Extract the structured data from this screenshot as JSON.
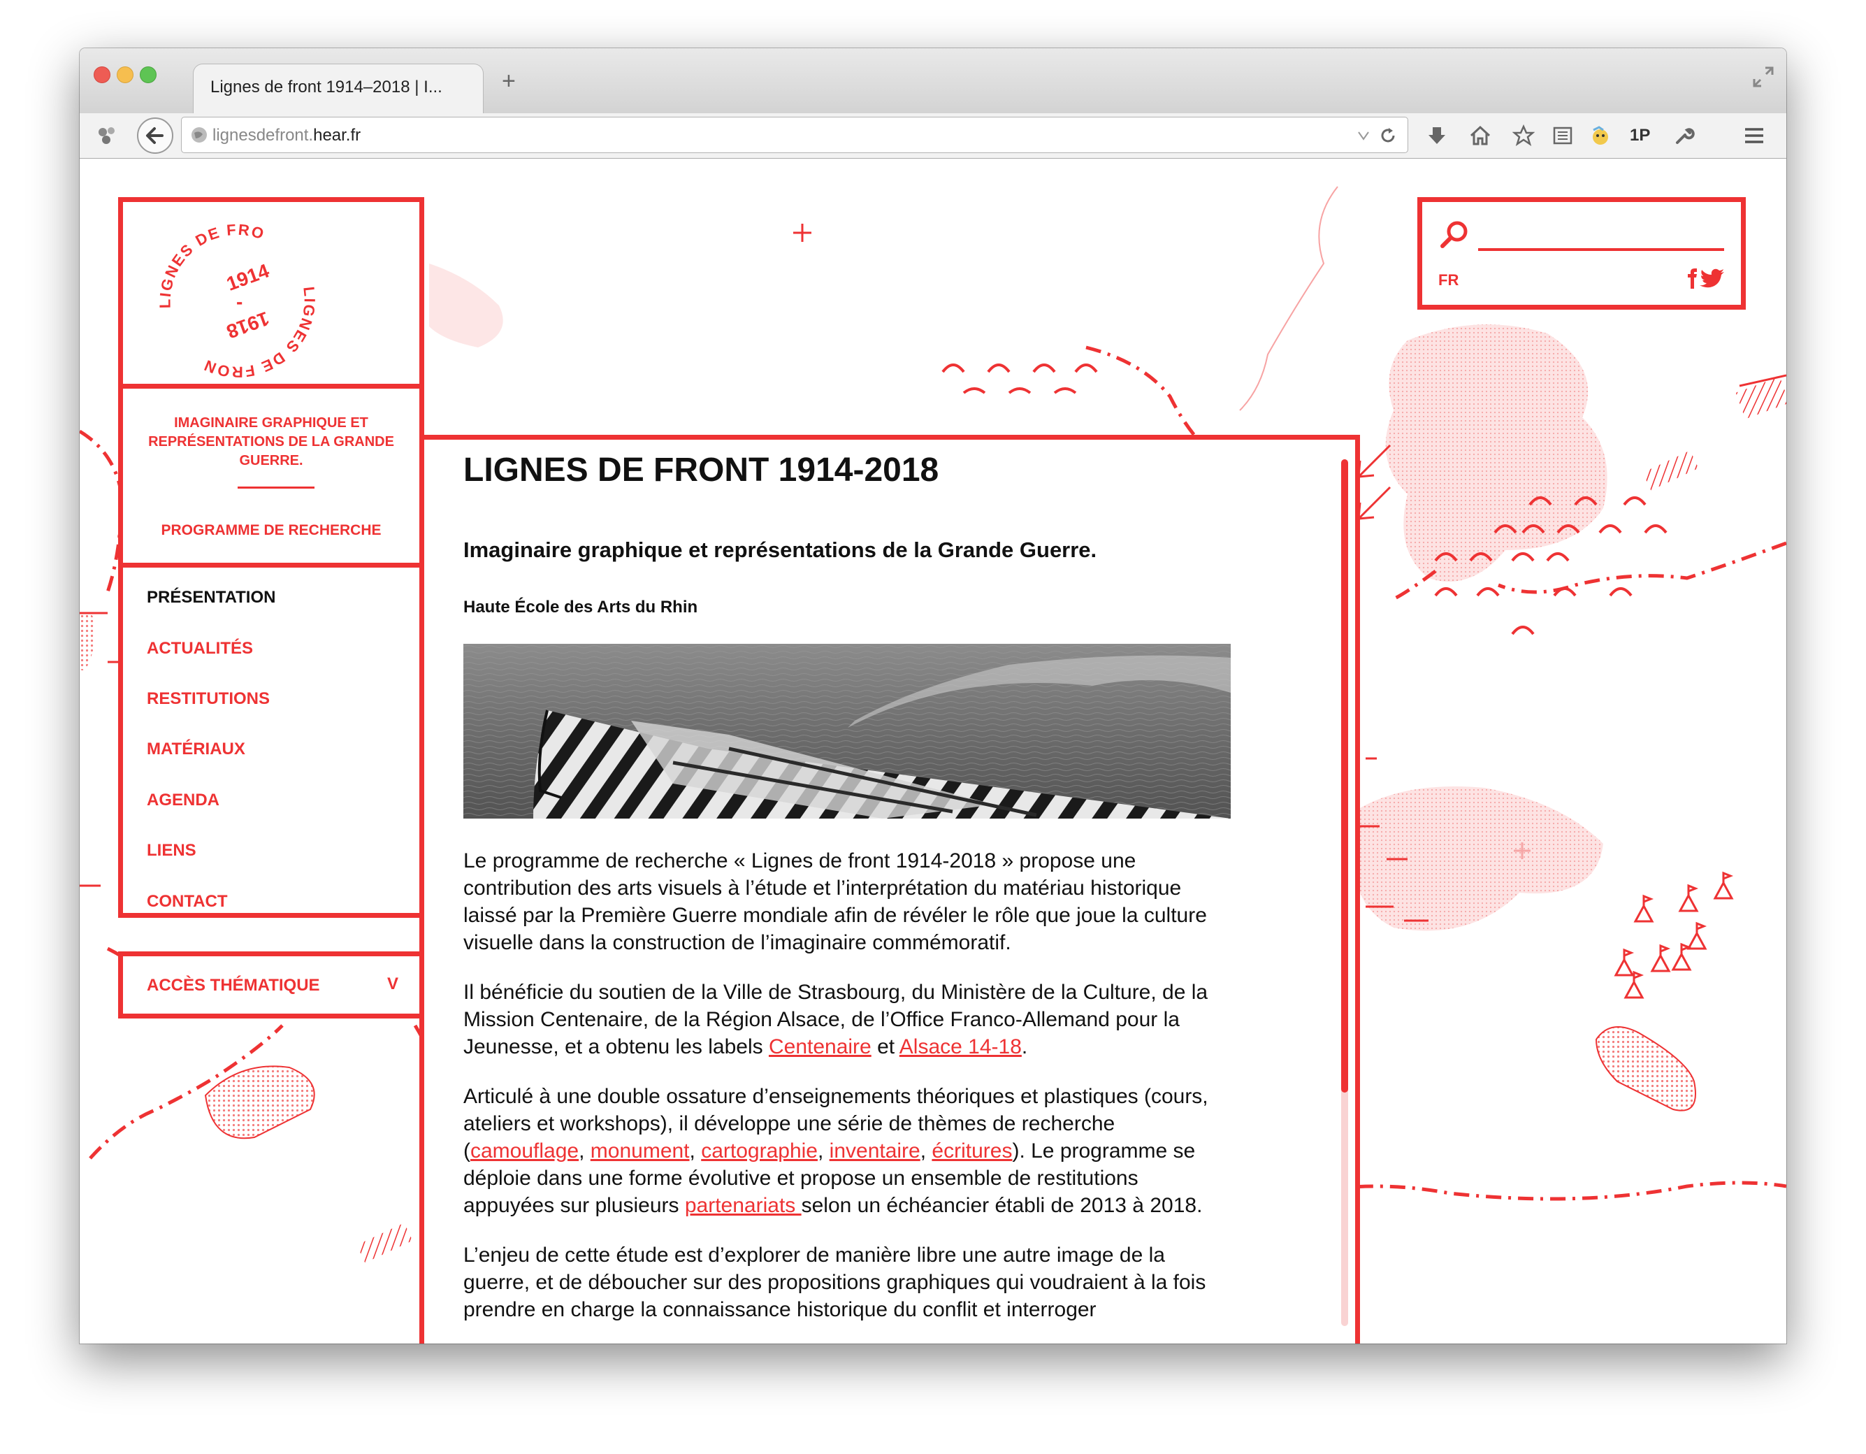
{
  "browser": {
    "tab_title": "Lignes de front 1914–2018 | I...",
    "new_tab": "+",
    "url_prefix": "lignesdefront.",
    "url_host": "hear.fr",
    "extension_label": "1P"
  },
  "logo": {
    "top_text": "LIGNES DE FRONT",
    "bottom_text": "LIGNES DE FRONT",
    "year_start": "1914",
    "year_end": "1918",
    "dash": "-"
  },
  "tagline": {
    "text": "IMAGINAIRE GRAPHIQUE ET REPRÉSENTATIONS DE LA GRANDE GUERRE.",
    "program": "PROGRAMME DE RECHERCHE"
  },
  "nav": {
    "items": [
      {
        "label": "PRÉSENTATION"
      },
      {
        "label": "ACTUALITÉS"
      },
      {
        "label": "RESTITUTIONS"
      },
      {
        "label": "MATÉRIAUX"
      },
      {
        "label": "AGENDA"
      },
      {
        "label": "LIENS"
      },
      {
        "label": "CONTACT"
      }
    ],
    "access_label": "ACCÈS THÉMATIQUE",
    "access_chevron": "V"
  },
  "search": {
    "language": "FR",
    "value": ""
  },
  "content": {
    "title": "LIGNES DE FRONT 1914-2018",
    "subtitle": "Imaginaire graphique et représentations de la Grande Guerre.",
    "school": "Haute École des Arts du Rhin",
    "p1": "Le programme de recherche « Lignes de front 1914-2018 » propose une contribution des arts visuels à l’étude et l’interprétation du matériau historique laissé par la Première Guerre mondiale afin de révéler le rôle que joue la culture visuelle dans la construction de l’imaginaire commémoratif.",
    "p2_a": "Il bénéficie du soutien de la Ville de Strasbourg, du Ministère de la Culture, de la Mission Centenaire, de la Région Alsace, de l’Office Franco-Allemand pour la Jeunesse, et a obtenu les labels ",
    "link_centenaire": "Centenaire",
    "p2_b": " et ",
    "link_alsace": "Alsace 14-18",
    "p2_c": ".",
    "p3_a": "Articulé à une double ossature d’enseignements théoriques et plastiques (cours, ateliers et workshops), il développe une série de thèmes de recherche (",
    "link_camouflage": "camouflage",
    "comma": ", ",
    "link_monument": "monument",
    "link_cartographie": "cartographie",
    "link_inventaire": "inventaire",
    "link_ecritures": "écritures",
    "p3_b": "). Le programme se déploie dans une forme évolutive et propose un ensemble de restitutions appuyées sur plusieurs ",
    "link_partenariats": "partenariats ",
    "p3_c": "selon un échéancier établi de 2013 à 2018.",
    "p4": "L’enjeu de cette étude est d’explorer de manière libre une autre image de la guerre, et de déboucher sur des propositions graphiques qui voudraient à la fois prendre en charge la connaissance historique du conflit et interroger"
  },
  "colors": {
    "accent": "#ee3233",
    "text": "#111111",
    "map_fill": "#fbe1e1"
  }
}
